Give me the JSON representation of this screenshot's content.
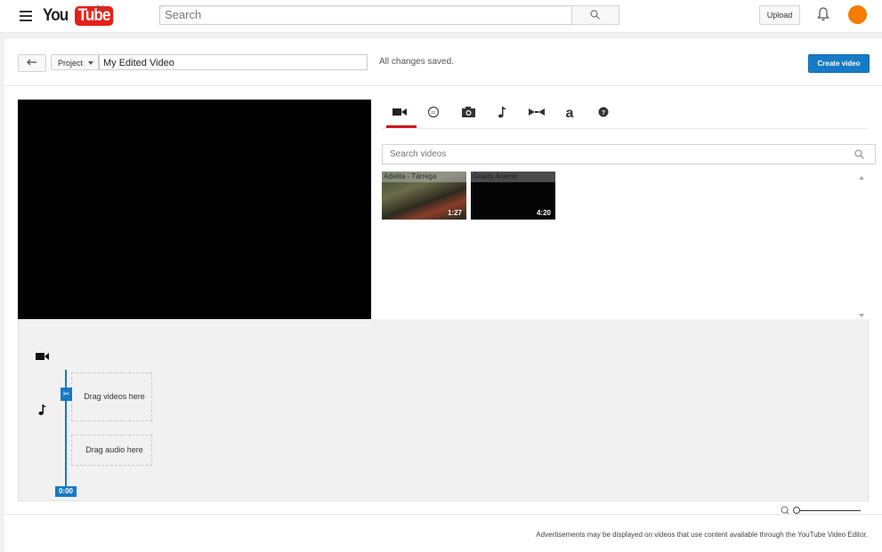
{
  "masthead": {
    "logo": {
      "you": "You",
      "tube": "Tube",
      "country": "CA"
    },
    "search": {
      "placeholder": "Search"
    },
    "upload_label": "Upload",
    "icons": [
      "menu-icon",
      "search-icon",
      "bell-icon",
      "avatar"
    ],
    "avatar_color": "#f57c00"
  },
  "toolbar": {
    "project_label": "Project",
    "title_value": "My Edited Video",
    "status": "All changes saved.",
    "create_label": "Create video",
    "accent": "#167ac6"
  },
  "library": {
    "tabs": [
      {
        "name": "videos",
        "icon": "video-camera-icon",
        "active": true
      },
      {
        "name": "cc",
        "icon": "creative-commons-icon"
      },
      {
        "name": "photos",
        "icon": "camera-icon"
      },
      {
        "name": "audio",
        "icon": "music-note-icon"
      },
      {
        "name": "transitions",
        "icon": "transition-icon"
      },
      {
        "name": "titles",
        "icon": "text-a-icon"
      },
      {
        "name": "help",
        "icon": "help-icon"
      }
    ],
    "search_placeholder": "Search videos",
    "videos": [
      {
        "title": "Adelita - Tárrega",
        "duration": "1:27"
      },
      {
        "title": "Gnarly Anemo",
        "duration": "4:20"
      }
    ]
  },
  "timeline": {
    "video_drop": "Drag videos here",
    "audio_drop": "Drag audio here",
    "playhead_time": "0:00",
    "scissors_icon": "scissors-icon"
  },
  "footer": {
    "text": "Advertisements may be displayed on videos that use content available through the YouTube Video Editor."
  }
}
